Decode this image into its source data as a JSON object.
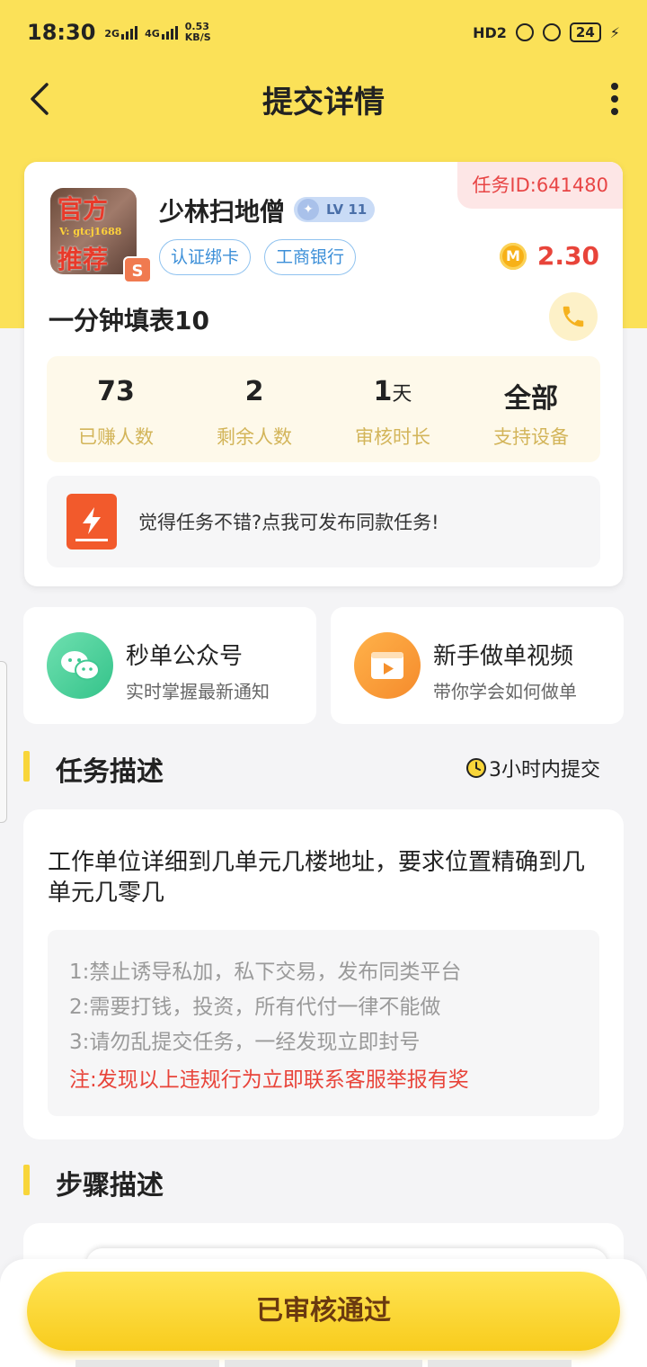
{
  "status_bar": {
    "time": "18:30",
    "net1": "2G",
    "net2": "4G",
    "speed_value": "0.53",
    "speed_unit": "KB/S",
    "hd": "HD2",
    "battery": "24"
  },
  "header": {
    "title": "提交详情"
  },
  "task": {
    "id_label": "任务ID:641480",
    "avatar_text_top": "官方",
    "avatar_text_bottom": "推荐",
    "avatar_watermark": "V: gtcj1688",
    "avatar_badge": "S",
    "username": "少林扫地僧",
    "level": "LV 11",
    "tags": [
      "认证绑卡",
      "工商银行"
    ],
    "coin_symbol": "M",
    "reward": "2.30",
    "title": "一分钟填表10",
    "stats": [
      {
        "value": "73",
        "unit": "",
        "label": "已赚人数"
      },
      {
        "value": "2",
        "unit": "",
        "label": "剩余人数"
      },
      {
        "value": "1",
        "unit": "天",
        "label": "审核时长"
      },
      {
        "value": "全部",
        "unit": "",
        "label": "支持设备"
      }
    ],
    "publish_text": "觉得任务不错?点我可发布同款任务!"
  },
  "quick_links": [
    {
      "title": "秒单公众号",
      "subtitle": "实时掌握最新通知",
      "icon": "wechat-icon"
    },
    {
      "title": "新手做单视频",
      "subtitle": "带你学会如何做单",
      "icon": "video-icon"
    }
  ],
  "description": {
    "section_title": "任务描述",
    "deadline": "3小时内提交",
    "text": "工作单位详细到几单元几楼地址，要求位置精确到几单元几零几",
    "rules": [
      "1:禁止诱导私加，私下交易，发布同类平台",
      "2:需要打钱，投资，所有代付一律不能做",
      "3:请勿乱提交任务，一经发现立即封号"
    ],
    "note": "注:发现以上违规行为立即联系客服举报有奖"
  },
  "steps": {
    "section_title": "步骤描述"
  },
  "bottom": {
    "button_label": "已审核通过"
  },
  "colors": {
    "brand_yellow": "#fbe158",
    "reward_red": "#e8443a",
    "tag_blue": "#3c8fd8"
  }
}
